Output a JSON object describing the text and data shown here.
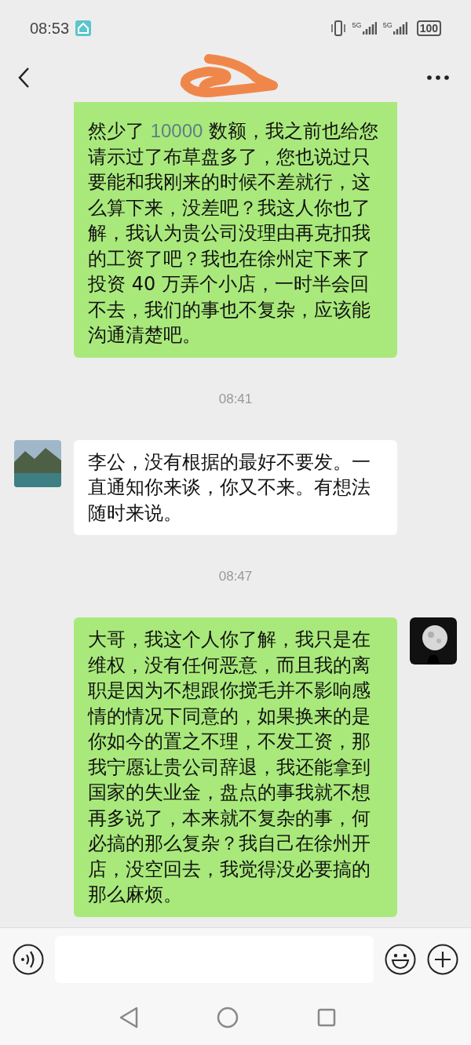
{
  "status_bar": {
    "time": "08:53",
    "network_1": "5G",
    "network_2": "5G",
    "battery": "100"
  },
  "messages": [
    {
      "kind": "sent",
      "parts": [
        {
          "kind": "plain",
          "text": "然少了 "
        },
        {
          "kind": "number",
          "text": "10000"
        },
        {
          "kind": "plain",
          "text": " 数额，我之前也给您请示过了布草盘多了，您也说过只要能和我刚来的时候不差就行，这么算下来，没差吧？我这人你也了解，我认为贵公司没理由再克扣我的工资了吧？我也在徐州定下来了投资 40 万弄个小店，一时半会回不去，我们的事也不复杂，应该能沟通清楚吧。"
        }
      ],
      "avatar": false
    },
    {
      "kind": "time",
      "text": "08:41"
    },
    {
      "kind": "received",
      "parts": [
        {
          "kind": "plain",
          "text": "李公，没有根据的最好不要发。一直通知你来谈，你又不来。有想法随时来说。"
        }
      ],
      "avatar": true
    },
    {
      "kind": "time",
      "text": "08:47"
    },
    {
      "kind": "sent",
      "parts": [
        {
          "kind": "plain",
          "text": "大哥，我这个人你了解，我只是在维权，没有任何恶意，而且我的离职是因为不想跟你搅毛并不影响感情的情况下同意的，如果换来的是你如今的置之不理，不发工资，那我宁愿让贵公司辞退，我还能拿到国家的失业金，盘点的事我就不想再多说了，本来就不复杂的事，何必搞的那么复杂？我自己在徐州开店，没空回去，我觉得没必要搞的那么麻烦。"
        }
      ],
      "avatar": true
    }
  ]
}
